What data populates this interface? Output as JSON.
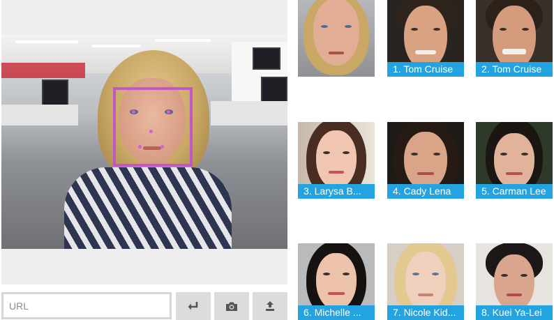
{
  "toolbar": {
    "url_placeholder": "URL",
    "submit_icon": "enter-arrow-icon",
    "camera_icon": "camera-icon",
    "upload_icon": "upload-icon"
  },
  "colors": {
    "face_box": "#c158c7",
    "caption_bg": "#23a3e0",
    "button_bg": "#dcdcdc",
    "panel_bg": "#eeeeee"
  },
  "results": [
    {
      "label": ""
    },
    {
      "label": "1. Tom Cruise"
    },
    {
      "label": "2. Tom Cruise"
    },
    {
      "label": "3. Larysa B..."
    },
    {
      "label": "4. Cady Lena"
    },
    {
      "label": "5. Carman Lee"
    },
    {
      "label": "6. Michelle ..."
    },
    {
      "label": "7. Nicole Kid..."
    },
    {
      "label": "8. Kuei Ya-Lei"
    }
  ]
}
